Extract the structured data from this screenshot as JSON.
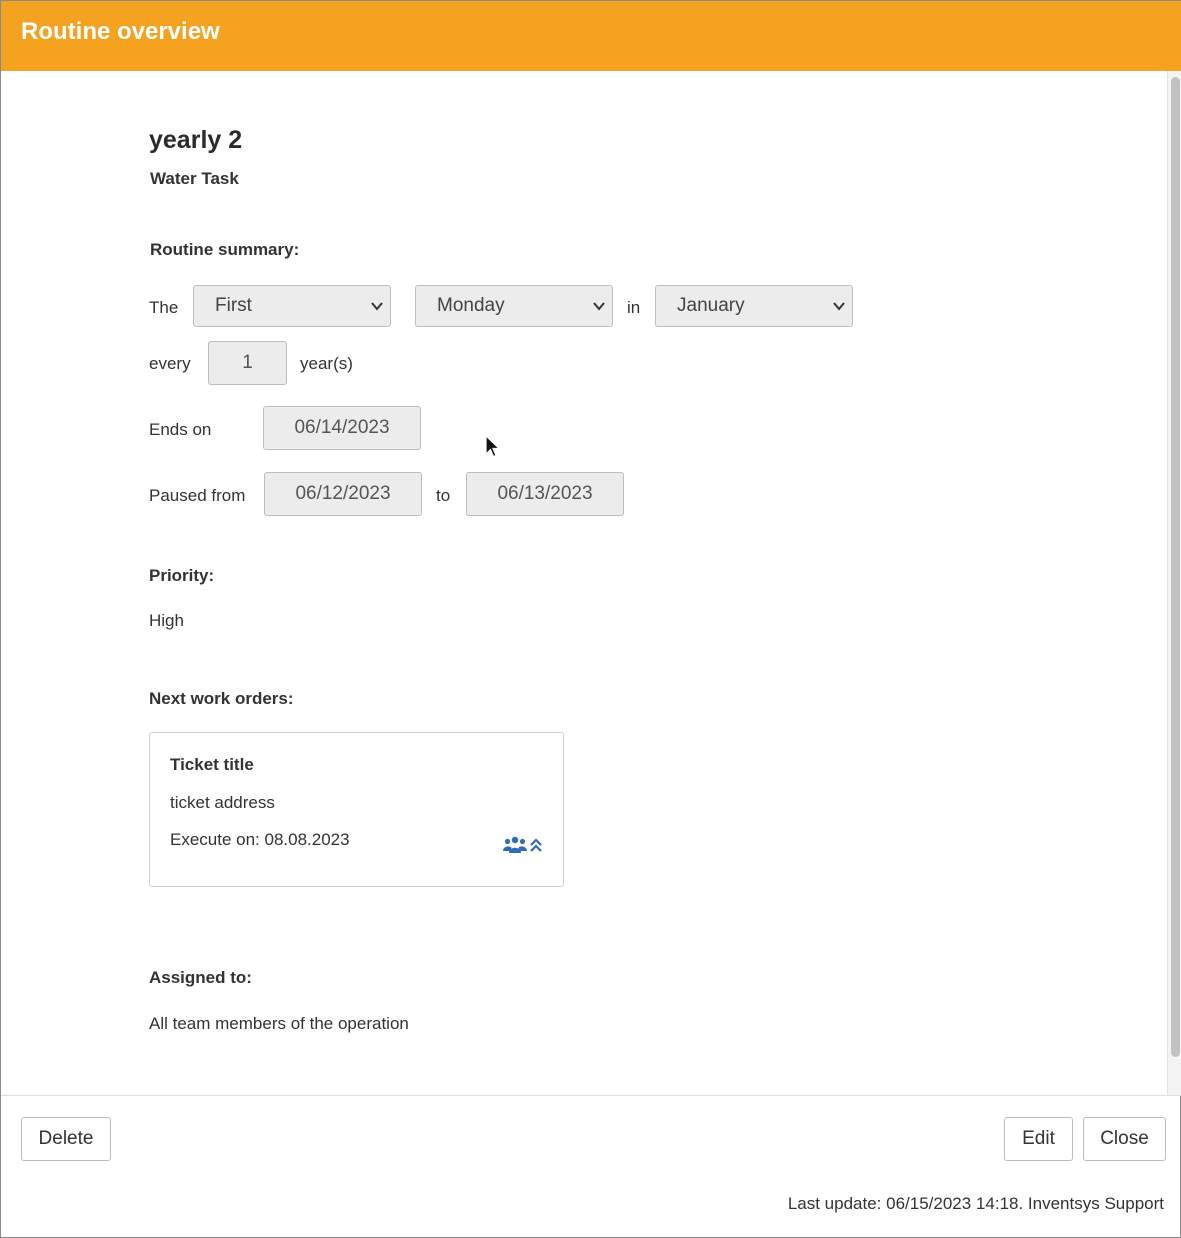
{
  "dialog": {
    "title": "Routine overview"
  },
  "routine": {
    "name": "yearly 2",
    "type": "Water Task"
  },
  "summary": {
    "label": "Routine summary:",
    "the_label": "The",
    "ordinal_select": "First",
    "weekday_select": "Monday",
    "in_label": "in",
    "month_select": "January",
    "every_label": "every",
    "interval_value": "1",
    "interval_unit": "year(s)",
    "ends_on_label": "Ends on",
    "ends_on_value": "06/14/2023",
    "paused_from_label": "Paused from",
    "paused_from_value": "06/12/2023",
    "to_label": "to",
    "paused_to_value": "06/13/2023"
  },
  "priority": {
    "label": "Priority:",
    "value": "High"
  },
  "work_orders": {
    "label": "Next work orders:",
    "items": [
      {
        "title": "Ticket title",
        "address": "ticket address",
        "execute_on": "Execute on: 08.08.2023",
        "icons": [
          "team-icon",
          "priority-high-icon"
        ]
      }
    ]
  },
  "assigned": {
    "label": "Assigned to:",
    "value": "All team members of the operation"
  },
  "footer": {
    "delete_label": "Delete",
    "edit_label": "Edit",
    "close_label": "Close",
    "last_update": "Last update: 06/15/2023 14:18. Inventsys Support"
  },
  "colors": {
    "header": "#f5a220",
    "icon_blue": "#2f6db3"
  }
}
